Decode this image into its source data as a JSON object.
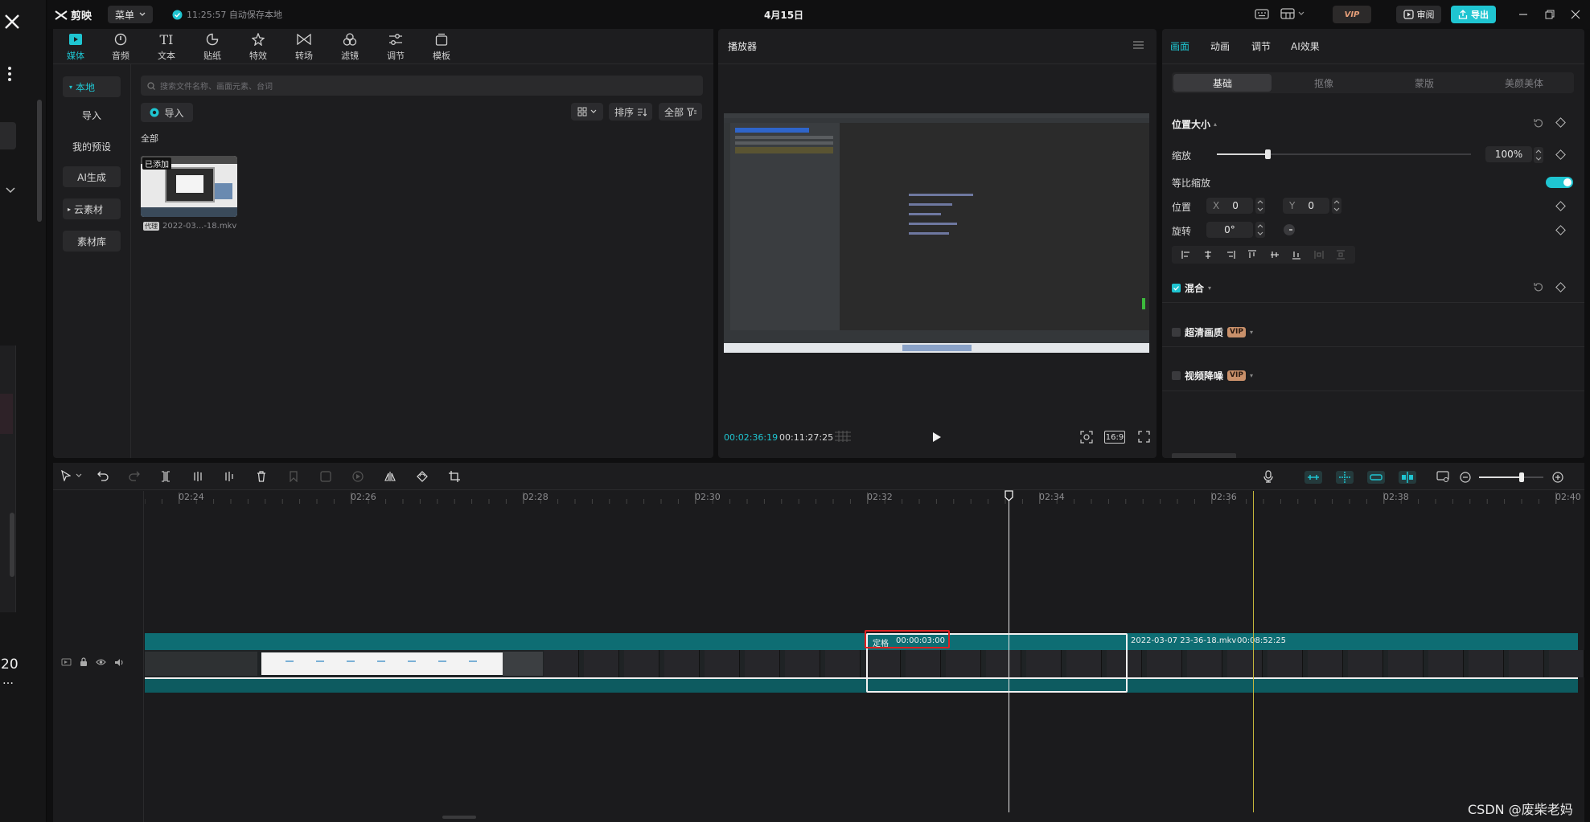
{
  "app": {
    "name": "剪映",
    "menu_label": "菜单",
    "autosave_text": "11:25:57 自动保存本地",
    "project_title": "4月15日",
    "vip_label": "VIP",
    "review_label": "审阅",
    "export_label": "导出"
  },
  "colors": {
    "accent": "#1fc5d1",
    "panel": "#1d1d1f",
    "clip_teal": "#0e6d73",
    "highlight_red": "#e02020",
    "playhead_yellow": "#c6b73c"
  },
  "media_tabs": [
    {
      "label": "媒体",
      "icon": "media-icon",
      "active": true
    },
    {
      "label": "音频",
      "icon": "audio-icon"
    },
    {
      "label": "文本",
      "icon": "text-icon"
    },
    {
      "label": "贴纸",
      "icon": "sticker-icon"
    },
    {
      "label": "特效",
      "icon": "effects-icon"
    },
    {
      "label": "转场",
      "icon": "transition-icon"
    },
    {
      "label": "滤镜",
      "icon": "filter-icon"
    },
    {
      "label": "调节",
      "icon": "adjust-icon"
    },
    {
      "label": "模板",
      "icon": "template-icon"
    }
  ],
  "media_sidebar": {
    "local": "本地",
    "import": "导入",
    "presets": "我的预设",
    "ai_gen": "AI生成",
    "cloud": "云素材",
    "library": "素材库"
  },
  "media_browser": {
    "search_placeholder": "搜索文件名称、画面元素、台词",
    "import_button": "导入",
    "sort_label": "排序",
    "filter_label": "全部",
    "section_label": "全部",
    "items": [
      {
        "badge": "已添加",
        "name": "2022-03...-18.mkv"
      }
    ]
  },
  "player": {
    "title": "播放器",
    "current_time": "00:02:36:19",
    "total_time": "00:11:27:25",
    "ratio": "16:9"
  },
  "inspector": {
    "tabs": [
      "画面",
      "动画",
      "调节",
      "AI效果"
    ],
    "subtabs": [
      "基础",
      "抠像",
      "蒙版",
      "美颜美体"
    ],
    "position_size": "位置大小",
    "scale_label": "缩放",
    "scale_value": "100%",
    "scale_level": 0.2,
    "uniform_scale": "等比缩放",
    "position_label": "位置",
    "x_label": "X",
    "x_value": "0",
    "y_label": "Y",
    "y_value": "0",
    "rotation_label": "旋转",
    "rotation_value": "0°",
    "blend_label": "混合",
    "hd_label": "超清画质",
    "denoise_label": "视频降噪",
    "vip_badge": "VIP"
  },
  "timeline": {
    "ticks": [
      "02:24",
      "02:26",
      "02:28",
      "02:30",
      "02:32",
      "02:34",
      "02:36",
      "02:38",
      "02:40"
    ],
    "freeze_label": "定格",
    "freeze_time": "00:00:03:00",
    "clip_name": "2022-03-07 23-36-18.mkv",
    "clip_duration": "00:08:52:25"
  },
  "left_strip": {
    "num_label": "20"
  },
  "watermark": "CSDN @废柴老妈"
}
